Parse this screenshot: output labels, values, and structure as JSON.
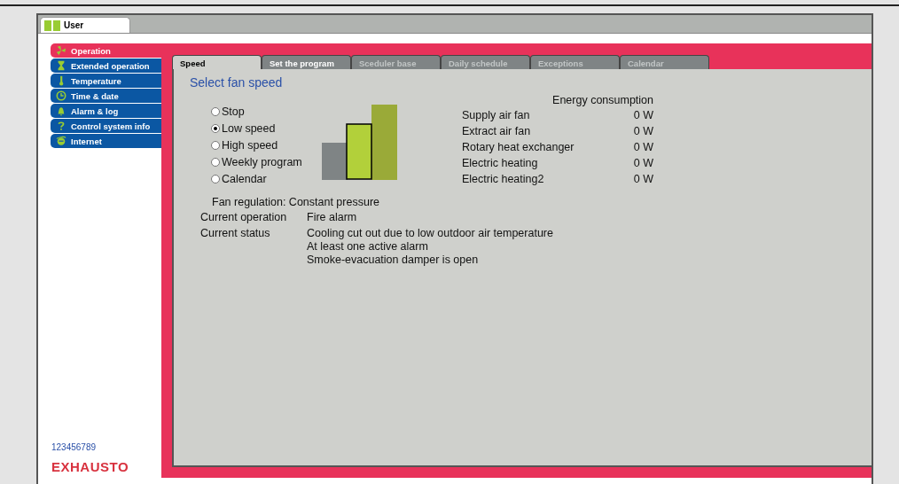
{
  "top_tab": {
    "label": "User"
  },
  "sidebar": {
    "items": [
      {
        "label": "Operation",
        "selected": true
      },
      {
        "label": "Extended operation",
        "selected": false
      },
      {
        "label": "Temperature",
        "selected": false
      },
      {
        "label": "Time & date",
        "selected": false
      },
      {
        "label": "Alarm & log",
        "selected": false
      },
      {
        "label": "Control system info",
        "selected": false
      },
      {
        "label": "Internet",
        "selected": false
      }
    ],
    "device_id": "123456789",
    "logo": "EXHAUSTO"
  },
  "tabs": [
    {
      "label": "Speed",
      "selected": true,
      "disabled": false
    },
    {
      "label": "Set the program",
      "selected": false,
      "disabled": false
    },
    {
      "label": "Sceduler base",
      "selected": false,
      "disabled": true
    },
    {
      "label": "Daily schedule",
      "selected": false,
      "disabled": true
    },
    {
      "label": "Exceptions",
      "selected": false,
      "disabled": true
    },
    {
      "label": "Calendar",
      "selected": false,
      "disabled": true
    }
  ],
  "heading": "Select fan speed",
  "speed_options": [
    {
      "label": "Stop",
      "selected": false
    },
    {
      "label": "Low speed",
      "selected": true
    },
    {
      "label": "High speed",
      "selected": false
    },
    {
      "label": "Weekly program",
      "selected": false
    },
    {
      "label": "Calendar",
      "selected": false
    }
  ],
  "energy": {
    "title": "Energy consumption",
    "rows": [
      {
        "name": "Supply air fan",
        "value": "0 W"
      },
      {
        "name": "Extract air fan",
        "value": "0 W"
      },
      {
        "name": "Rotary heat exchanger",
        "value": "0 W"
      },
      {
        "name": "Electric heating",
        "value": "0 W"
      },
      {
        "name": "Electric heating2",
        "value": "0 W"
      }
    ]
  },
  "fan_regulation": "Fan regulation: Constant pressure",
  "info": [
    {
      "label": "Current operation",
      "lines": [
        "Fire alarm"
      ]
    },
    {
      "label": "Current status",
      "lines": [
        "Cooling cut out due to low outdoor air temperature",
        "At least one active alarm",
        "Smoke-evacuation damper is open"
      ]
    }
  ]
}
